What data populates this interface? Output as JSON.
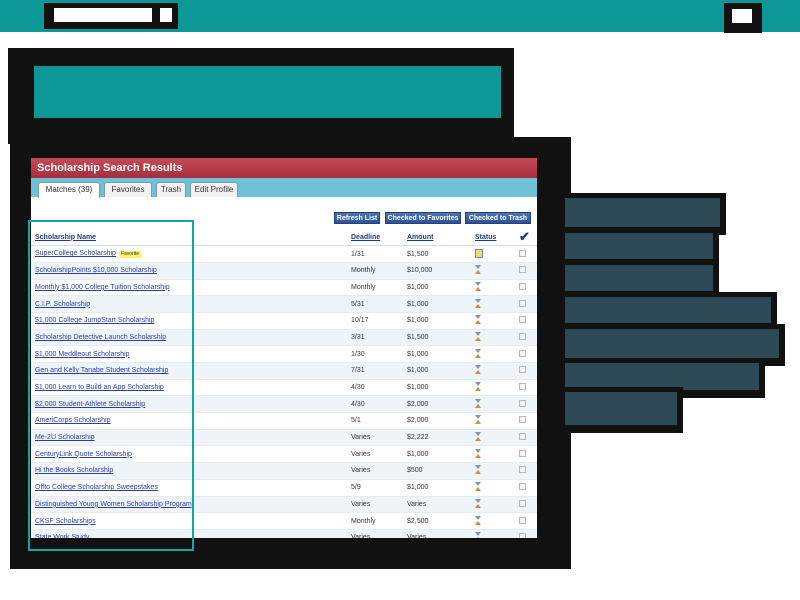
{
  "panel": {
    "title": "Scholarship Search Results",
    "tabs": [
      {
        "label": "Matches (39)",
        "active": true
      },
      {
        "label": "Favorites",
        "active": false
      },
      {
        "label": "Trash",
        "active": false
      },
      {
        "label": "Edit Profile",
        "active": false
      }
    ],
    "buttons": {
      "refresh": "Refresh List",
      "favorites": "Checked to Favorites",
      "trash": "Checked to Trash"
    },
    "columns": {
      "name": "Scholarship Name",
      "deadline": "Deadline",
      "amount": "Amount",
      "status": "Status"
    },
    "favorite_badge": "Favorite",
    "rows": [
      {
        "name": "SuperCollege Scholarship",
        "deadline": "1/31",
        "amount": "$1,500",
        "favorite": true,
        "status": "note"
      },
      {
        "name": "ScholarshipPoints $10,000 Scholarship",
        "deadline": "Monthly",
        "amount": "$10,000",
        "favorite": false,
        "status": "pending"
      },
      {
        "name": "Monthly $1,000 College Tuition Scholarship",
        "deadline": "Monthly",
        "amount": "$1,000",
        "favorite": false,
        "status": "pending"
      },
      {
        "name": "C.I.P. Scholarship",
        "deadline": "5/31",
        "amount": "$1,000",
        "favorite": false,
        "status": "pending"
      },
      {
        "name": "$1,000 College JumpStart Scholarship",
        "deadline": "10/17",
        "amount": "$1,000",
        "favorite": false,
        "status": "pending"
      },
      {
        "name": "Scholarship Detective Launch Scholarship",
        "deadline": "3/31",
        "amount": "$1,500",
        "favorite": false,
        "status": "pending"
      },
      {
        "name": "$1,000 Meddleout Scholarship",
        "deadline": "1/30",
        "amount": "$1,000",
        "favorite": false,
        "status": "pending"
      },
      {
        "name": "Gen and Kelly Tanabe Student Scholarship",
        "deadline": "7/31",
        "amount": "$1,000",
        "favorite": false,
        "status": "pending"
      },
      {
        "name": "$1,000 Learn to Build an App Scholarship",
        "deadline": "4/30",
        "amount": "$1,000",
        "favorite": false,
        "status": "pending"
      },
      {
        "name": "$2,000 Student-Athlete Scholarship",
        "deadline": "4/30",
        "amount": "$2,000",
        "favorite": false,
        "status": "pending"
      },
      {
        "name": "AmeriCorps Scholarship",
        "deadline": "5/1",
        "amount": "$2,000",
        "favorite": false,
        "status": "pending"
      },
      {
        "name": "Me-2U Scholarship",
        "deadline": "Varies",
        "amount": "$2,222",
        "favorite": false,
        "status": "pending"
      },
      {
        "name": "CenturyLink Quote Scholarship",
        "deadline": "Varies",
        "amount": "$1,000",
        "favorite": false,
        "status": "pending"
      },
      {
        "name": "Hi the Books Scholarship",
        "deadline": "Varies",
        "amount": "$500",
        "favorite": false,
        "status": "pending"
      },
      {
        "name": "Offto College Scholarship Sweepstakes",
        "deadline": "5/9",
        "amount": "$1,000",
        "favorite": false,
        "status": "pending"
      },
      {
        "name": "Distinguished Young Women Scholarship Program",
        "deadline": "Varies",
        "amount": "Varies",
        "favorite": false,
        "status": "pending"
      },
      {
        "name": "CKSF Scholarships",
        "deadline": "Monthly",
        "amount": "$2,500",
        "favorite": false,
        "status": "pending"
      },
      {
        "name": "State Work Study",
        "deadline": "Varies",
        "amount": "Varies",
        "favorite": false,
        "status": "pending"
      }
    ]
  },
  "colors": {
    "teal": "#0d9796",
    "header_red": "#b43a47",
    "tab_bar": "#6fc1d8",
    "link_blue": "#2a3ea8",
    "highlight": "#14a5a3"
  }
}
